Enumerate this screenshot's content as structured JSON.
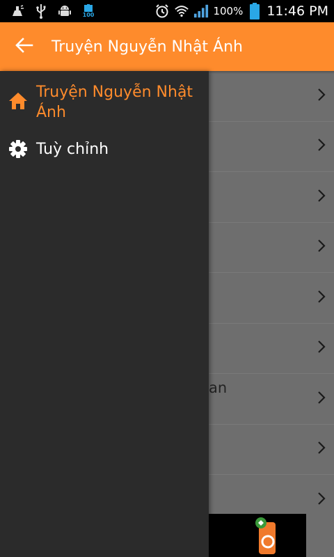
{
  "status_bar": {
    "time": "11:46 PM",
    "battery_percent": "100%",
    "notification_badge": "100",
    "icons": [
      "cleaner-icon",
      "usb-icon",
      "android-debug-icon",
      "battery-100-icon",
      "alarm-icon",
      "wifi-icon",
      "signal-icon",
      "battery-icon"
    ]
  },
  "app_bar": {
    "title": "Truyện Nguyễn Nhật Ánh",
    "back_icon": "back-arrow-icon"
  },
  "drawer": {
    "items": [
      {
        "label": "Truyện Nguyễn Nhật Ánh",
        "icon": "home-icon",
        "active": true
      },
      {
        "label": "Tuỳ chỉnh",
        "icon": "gear-icon",
        "active": false
      }
    ]
  },
  "content": {
    "partial_text": "an"
  },
  "colors": {
    "accent": "#fe8b2c",
    "drawer_bg": "#2b2b2b",
    "scrim": "#6e6e6e"
  }
}
